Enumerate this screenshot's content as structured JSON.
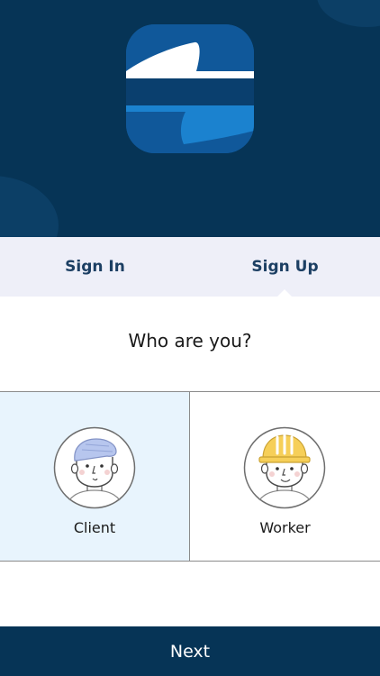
{
  "tabs": [
    {
      "label": "Sign In",
      "active": false
    },
    {
      "label": "Sign Up",
      "active": true
    }
  ],
  "question": "Who are you?",
  "roles": [
    {
      "label": "Client",
      "selected": true,
      "icon": "client-avatar-icon"
    },
    {
      "label": "Worker",
      "selected": false,
      "icon": "worker-avatar-icon"
    }
  ],
  "next_label": "Next",
  "colors": {
    "brand_dark": "#063456",
    "tab_bar": "#eeeff8",
    "tab_text": "#1c3f63",
    "selected_bg": "#e8f4fd"
  }
}
